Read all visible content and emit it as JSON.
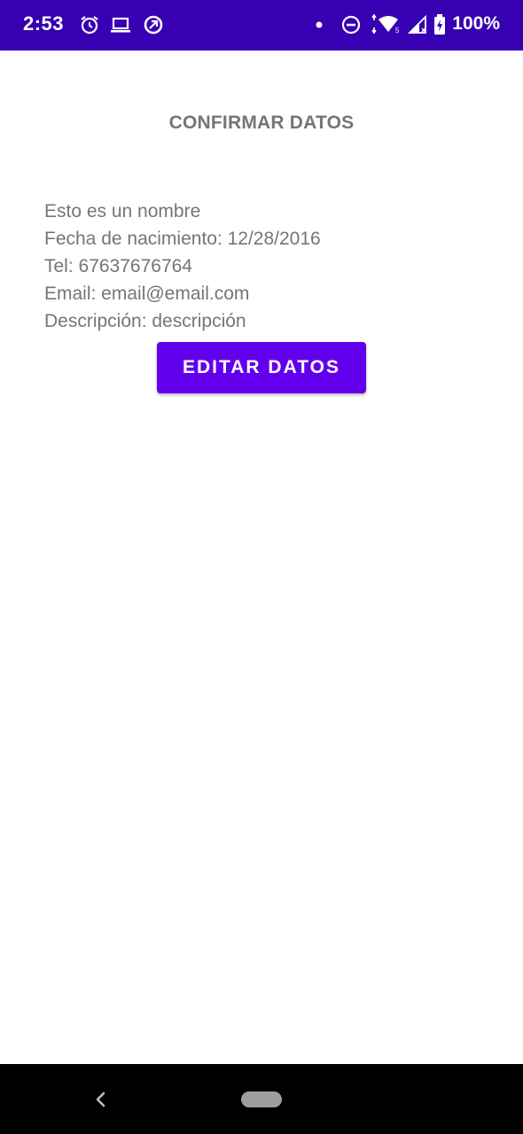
{
  "status_bar": {
    "time": "2:53",
    "battery_percent": "100%",
    "icons": [
      "alarm-icon",
      "laptop-icon",
      "data-saver-icon",
      "notification-dot-icon",
      "do-not-disturb-icon",
      "wifi-icon",
      "cell-signal-icon",
      "battery-charging-icon"
    ],
    "background_color": "#3700b3"
  },
  "page": {
    "title": "CONFIRMAR DATOS"
  },
  "details": {
    "name": "Esto es un nombre",
    "birth_date": "Fecha de nacimiento: 12/28/2016",
    "phone": "Tel: 67637676764",
    "email": "Email: email@email.com",
    "description": "Descripción: descripción"
  },
  "actions": {
    "edit_label": "EDITAR DATOS",
    "button_color": "#6200ee"
  },
  "nav_bar": {
    "icons": [
      "back-icon",
      "home-pill-icon"
    ]
  }
}
